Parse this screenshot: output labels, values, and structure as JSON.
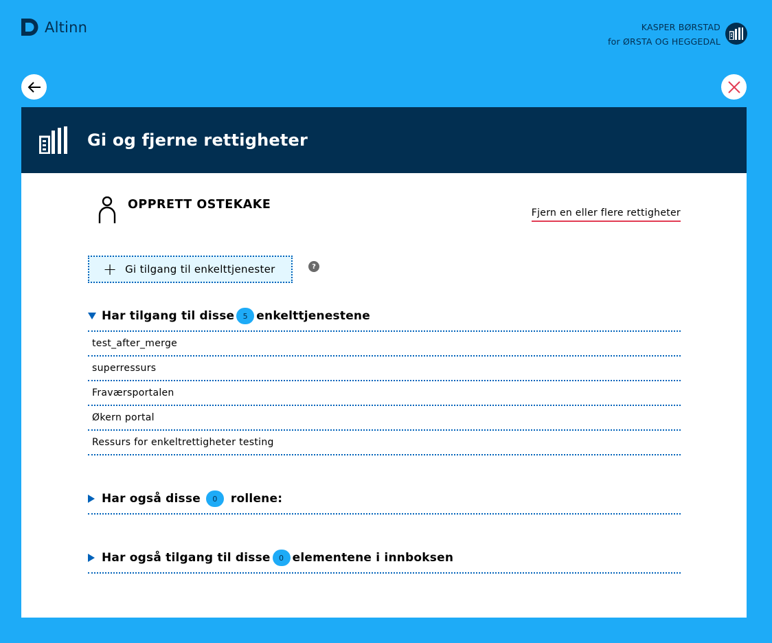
{
  "header": {
    "logo_text": "Altinn",
    "user_name": "KASPER BØRSTAD",
    "user_org": "for ØRSTA OG HEGGEDAL"
  },
  "modal": {
    "title": "Gi og fjerne rettigheter",
    "person_name": "OPPRETT OSTEKAKE",
    "remove_link": "Fjern en eller flere rettigheter",
    "add_button_label": "Gi tilgang til enkelttjenester",
    "help_symbol": "?"
  },
  "sections": {
    "services": {
      "prefix": "Har tilgang til disse",
      "count": "5",
      "suffix": "enkelttjenestene",
      "expanded": true,
      "items": [
        "test_after_merge",
        "superressurs",
        "Fraværsportalen",
        "Økern portal",
        "Ressurs for enkeltrettigheter testing"
      ]
    },
    "roles": {
      "prefix": "Har også disse",
      "count": "0",
      "suffix": "rollene:",
      "expanded": false
    },
    "inbox": {
      "prefix": "Har også tilgang til disse",
      "count": "0",
      "suffix": "elementene i innboksen",
      "expanded": false
    }
  },
  "colors": {
    "background": "#1eabf7",
    "navy": "#022f51",
    "accent_red": "#e23b53",
    "dotted_blue": "#0062ba",
    "add_button_bg": "#e3f7ff"
  },
  "icons": {
    "logo": "altinn-logo-icon",
    "avatar": "building-icon",
    "back": "arrow-left-icon",
    "close": "close-icon",
    "modal_header": "building-icon",
    "person": "person-icon",
    "plus": "plus-icon",
    "help": "help-icon",
    "expanded": "caret-down-icon",
    "collapsed": "caret-right-icon"
  }
}
